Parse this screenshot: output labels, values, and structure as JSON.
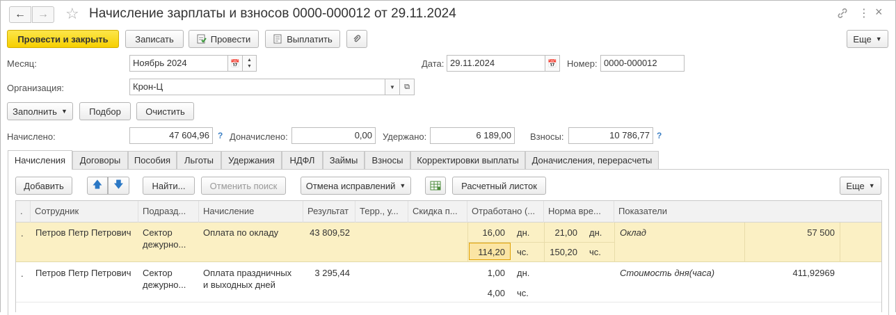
{
  "window": {
    "title": "Начисление зарплаты и взносов 0000-000012 от 29.11.2024"
  },
  "toolbar": {
    "post_close": "Провести и закрыть",
    "save": "Записать",
    "post": "Провести",
    "pay": "Выплатить",
    "more": "Еще"
  },
  "form": {
    "month_label": "Месяц:",
    "month_value": "Ноябрь 2024",
    "date_label": "Дата:",
    "date_value": "29.11.2024",
    "number_label": "Номер:",
    "number_value": "0000-000012",
    "org_label": "Организация:",
    "org_value": "Крон-Ц",
    "fill": "Заполнить",
    "select": "Подбор",
    "clear": "Очистить",
    "accrued_label": "Начислено:",
    "accrued_value": "47 604,96",
    "additional_label": "Доначислено:",
    "additional_value": "0,00",
    "withheld_label": "Удержано:",
    "withheld_value": "6 189,00",
    "contrib_label": "Взносы:",
    "contrib_value": "10 786,77",
    "help": "?"
  },
  "tabs": [
    "Начисления",
    "Договоры",
    "Пособия",
    "Льготы",
    "Удержания",
    "НДФЛ",
    "Займы",
    "Взносы",
    "Корректировки выплаты",
    "Доначисления, перерасчеты"
  ],
  "table_toolbar": {
    "add": "Добавить",
    "find": "Найти...",
    "cancel_search": "Отменить поиск",
    "cancel_fixes": "Отмена исправлений",
    "payslip": "Расчетный листок",
    "more": "Еще"
  },
  "columns": [
    "Сотрудник",
    "Подразд...",
    "Начисление",
    "Результат",
    "Терр., у...",
    "Скидка п...",
    "Отработано (...",
    "Норма вре...",
    "Показатели"
  ],
  "rows": [
    {
      "marker": ".",
      "employee": "Петров Петр Петрович",
      "dept1": "Сектор",
      "dept2": "дежурно...",
      "accrual1": "Оплата по окладу",
      "accrual2": "",
      "result": "43 809,52",
      "worked_days": "16,00",
      "worked_days_unit": "дн.",
      "worked_hours": "114,20",
      "worked_hours_unit": "чс.",
      "norm_days": "21,00",
      "norm_days_unit": "дн.",
      "norm_hours": "150,20",
      "norm_hours_unit": "чс.",
      "indicator": "Оклад",
      "indicator_value": "57 500"
    },
    {
      "marker": ".",
      "employee": "Петров Петр Петрович",
      "dept1": "Сектор",
      "dept2": "дежурно...",
      "accrual1": "Оплата праздничных",
      "accrual2": "и выходных дней",
      "result": "3 295,44",
      "worked_days": "1,00",
      "worked_days_unit": "дн.",
      "worked_hours": "4,00",
      "worked_hours_unit": "чс.",
      "indicator": "Стоимость дня(часа)",
      "indicator_value": "411,92969"
    }
  ]
}
